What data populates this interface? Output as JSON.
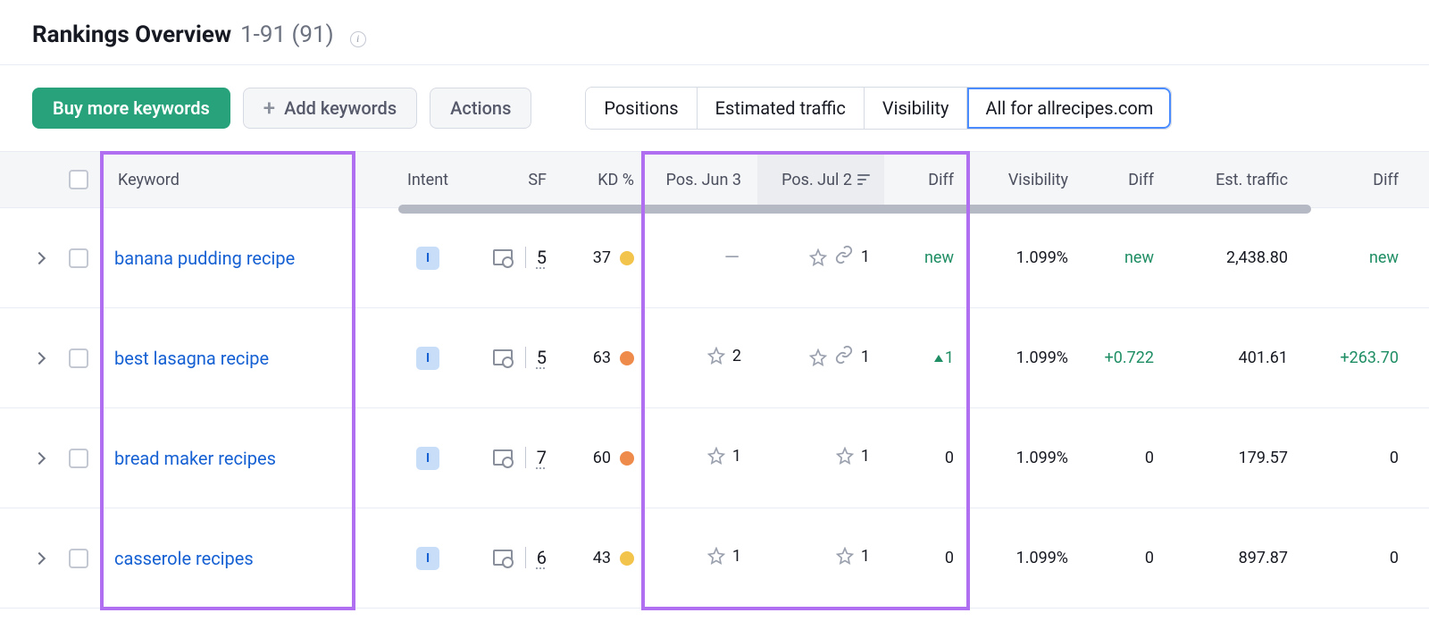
{
  "header": {
    "title": "Rankings Overview",
    "range": "1-91 (91)"
  },
  "toolbar": {
    "buy": "Buy more keywords",
    "add": "Add keywords",
    "actions": "Actions",
    "seg": [
      "Positions",
      "Estimated traffic",
      "Visibility",
      "All for allrecipes.com"
    ]
  },
  "columns": {
    "keyword": "Keyword",
    "intent": "Intent",
    "sf": "SF",
    "kd": "KD %",
    "pos1": "Pos. Jun 3",
    "pos2": "Pos. Jul 2",
    "diff": "Diff",
    "vis": "Visibility",
    "diff2": "Diff",
    "est": "Est. traffic",
    "diff3": "Diff"
  },
  "rows": [
    {
      "keyword": "banana pudding recipe",
      "intent": "I",
      "sf": "5",
      "kd": "37",
      "kd_color": "yellow",
      "pos1": "—",
      "pos1_dash": true,
      "pos2": "1",
      "pos2_link": true,
      "diff": "new",
      "diff_class": "new",
      "vis": "1.099%",
      "vis_diff": "new",
      "vis_diff_class": "new",
      "est": "2,438.80",
      "est_diff": "new",
      "est_diff_class": "new"
    },
    {
      "keyword": "best lasagna recipe",
      "intent": "I",
      "sf": "5",
      "kd": "63",
      "kd_color": "orange",
      "pos1": "2",
      "pos1_dash": false,
      "pos2": "1",
      "pos2_link": true,
      "diff": "1",
      "diff_arrow": true,
      "diff_class": "green",
      "vis": "1.099%",
      "vis_diff": "+0.722",
      "vis_diff_class": "green",
      "est": "401.61",
      "est_diff": "+263.70",
      "est_diff_class": "green"
    },
    {
      "keyword": "bread maker recipes",
      "intent": "I",
      "sf": "7",
      "kd": "60",
      "kd_color": "orange",
      "pos1": "1",
      "pos1_dash": false,
      "pos2": "1",
      "pos2_link": false,
      "diff": "0",
      "diff_class": "",
      "vis": "1.099%",
      "vis_diff": "0",
      "vis_diff_class": "",
      "est": "179.57",
      "est_diff": "0",
      "est_diff_class": ""
    },
    {
      "keyword": "casserole recipes",
      "intent": "I",
      "sf": "6",
      "kd": "43",
      "kd_color": "yellow",
      "pos1": "1",
      "pos1_dash": false,
      "pos2": "1",
      "pos2_link": false,
      "diff": "0",
      "diff_class": "",
      "vis": "1.099%",
      "vis_diff": "0",
      "vis_diff_class": "",
      "est": "897.87",
      "est_diff": "0",
      "est_diff_class": ""
    }
  ]
}
